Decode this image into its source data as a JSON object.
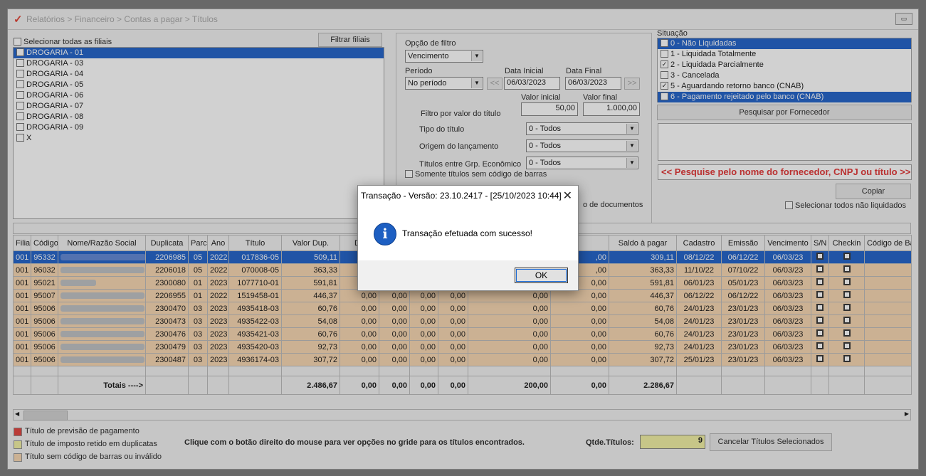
{
  "window": {
    "title": "Relatórios > Financeiro > Contas a pagar > Títulos",
    "restore_label": "▭"
  },
  "filiais": {
    "select_all_label": "Selecionar todas as filiais",
    "filter_button": "Filtrar filiais",
    "items": [
      {
        "label": "DROGARIA - 01",
        "checked": true
      },
      {
        "label": "DROGARIA - 03",
        "checked": false
      },
      {
        "label": "DROGARIA - 04",
        "checked": false
      },
      {
        "label": "DROGARIA - 05",
        "checked": false
      },
      {
        "label": "DROGARIA - 06",
        "checked": false
      },
      {
        "label": "DROGARIA - 07",
        "checked": false
      },
      {
        "label": "DROGARIA - 08",
        "checked": false
      },
      {
        "label": "DROGARIA - 09",
        "checked": false
      },
      {
        "label": "X",
        "checked": false
      }
    ]
  },
  "filter": {
    "option_label": "Opção de filtro",
    "option_value": "Vencimento",
    "period_label": "Período",
    "period_value": "No período",
    "prev_btn": "<<",
    "next_btn": ">>",
    "start_label": "Data Inicial",
    "start_value": "06/03/2023",
    "end_label": "Data Final",
    "end_value": "06/03/2023",
    "min_label": "Valor inicial",
    "max_label": "Valor final",
    "min_value": "50,00",
    "max_value": "1.000,00",
    "by_value_label": "Filtro por valor do título",
    "type_label": "Tipo do título",
    "type_value": "0 - Todos",
    "origin_label": "Origem do lançamento",
    "origin_value": "0 - Todos",
    "group_label": "Títulos entre Grp. Econômico",
    "group_value": "0 - Todos",
    "no_barcode_label": "Somente títulos sem código de barras",
    "docs_label": "o de documentos"
  },
  "situacao": {
    "label": "Situação",
    "items": [
      {
        "label": "0 - Não Liquidadas",
        "checked": true,
        "selected": true
      },
      {
        "label": "1 - Liquidada Totalmente",
        "checked": false,
        "selected": false
      },
      {
        "label": "2 - Liquidada Parcialmente",
        "checked": true,
        "selected": false
      },
      {
        "label": "3 - Cancelada",
        "checked": false,
        "selected": false
      },
      {
        "label": "5 - Aguardando retorno banco (CNAB)",
        "checked": true,
        "selected": false
      },
      {
        "label": "6 - Pagamento rejeitado pelo banco (CNAB)",
        "checked": true,
        "selected": true
      }
    ],
    "search_button": "Pesquisar por Fornecedor",
    "hint": "<< Pesquise pelo nome do fornecedor, CNPJ ou título >>",
    "copy_button": "Copiar",
    "select_unpaid_label": "Selecionar todos não liquidados"
  },
  "grid": {
    "columns": [
      "Filial",
      "Código",
      "Nome/Razão Social",
      "Duplicata",
      "Parc",
      "Ano",
      "Título",
      "Valor Dup.",
      "De",
      "",
      "",
      "",
      "",
      "",
      "Saldo à pagar",
      "Cadastro",
      "Emissão",
      "Vencimento",
      "S/N",
      "Checkin",
      "Código de Barras"
    ],
    "rows": [
      {
        "filial": "001",
        "codigo": "95332",
        "dup": "2206985",
        "parc": "05",
        "ano": "2022",
        "titulo": "017836-05",
        "valor": "509,11",
        "c1": "",
        "c2": "",
        "c3": "",
        "c4": "",
        "c5": "",
        "c6": ",00",
        "saldo": "309,11",
        "cadastro": "08/12/22",
        "emissao": "06/12/22",
        "venc": "06/03/23",
        "selected": true,
        "name_w": 120
      },
      {
        "filial": "001",
        "codigo": "96032",
        "dup": "2206018",
        "parc": "05",
        "ano": "2022",
        "titulo": "070008-05",
        "valor": "363,33",
        "c1": "",
        "c2": "",
        "c3": "",
        "c4": "",
        "c5": "",
        "c6": ",00",
        "saldo": "363,33",
        "cadastro": "11/10/22",
        "emissao": "07/10/22",
        "venc": "06/03/23",
        "selected": false,
        "name_w": 118
      },
      {
        "filial": "001",
        "codigo": "95021",
        "dup": "2300080",
        "parc": "01",
        "ano": "2023",
        "titulo": "1077710-01",
        "valor": "591,81",
        "c1": "0,00",
        "c2": "0,00",
        "c3": "0,00",
        "c4": "0,00",
        "c5": "0,00",
        "c6": "0,00",
        "saldo": "591,81",
        "cadastro": "06/01/23",
        "emissao": "05/01/23",
        "venc": "06/03/23",
        "selected": false,
        "name_w": 50
      },
      {
        "filial": "001",
        "codigo": "95007",
        "dup": "2206955",
        "parc": "01",
        "ano": "2022",
        "titulo": "1519458-01",
        "valor": "446,37",
        "c1": "0,00",
        "c2": "0,00",
        "c3": "0,00",
        "c4": "0,00",
        "c5": "0,00",
        "c6": "0,00",
        "saldo": "446,37",
        "cadastro": "06/12/22",
        "emissao": "06/12/22",
        "venc": "06/03/23",
        "selected": false,
        "name_w": 118
      },
      {
        "filial": "001",
        "codigo": "95006",
        "dup": "2300470",
        "parc": "03",
        "ano": "2023",
        "titulo": "4935418-03",
        "valor": "60,76",
        "c1": "0,00",
        "c2": "0,00",
        "c3": "0,00",
        "c4": "0,00",
        "c5": "0,00",
        "c6": "0,00",
        "saldo": "60,76",
        "cadastro": "24/01/23",
        "emissao": "23/01/23",
        "venc": "06/03/23",
        "selected": false,
        "name_w": 118
      },
      {
        "filial": "001",
        "codigo": "95006",
        "dup": "2300473",
        "parc": "03",
        "ano": "2023",
        "titulo": "4935422-03",
        "valor": "54,08",
        "c1": "0,00",
        "c2": "0,00",
        "c3": "0,00",
        "c4": "0,00",
        "c5": "0,00",
        "c6": "0,00",
        "saldo": "54,08",
        "cadastro": "24/01/23",
        "emissao": "23/01/23",
        "venc": "06/03/23",
        "selected": false,
        "name_w": 118
      },
      {
        "filial": "001",
        "codigo": "95006",
        "dup": "2300476",
        "parc": "03",
        "ano": "2023",
        "titulo": "4935421-03",
        "valor": "60,76",
        "c1": "0,00",
        "c2": "0,00",
        "c3": "0,00",
        "c4": "0,00",
        "c5": "0,00",
        "c6": "0,00",
        "saldo": "60,76",
        "cadastro": "24/01/23",
        "emissao": "23/01/23",
        "venc": "06/03/23",
        "selected": false,
        "name_w": 118
      },
      {
        "filial": "001",
        "codigo": "95006",
        "dup": "2300479",
        "parc": "03",
        "ano": "2023",
        "titulo": "4935420-03",
        "valor": "92,73",
        "c1": "0,00",
        "c2": "0,00",
        "c3": "0,00",
        "c4": "0,00",
        "c5": "0,00",
        "c6": "0,00",
        "saldo": "92,73",
        "cadastro": "24/01/23",
        "emissao": "23/01/23",
        "venc": "06/03/23",
        "selected": false,
        "name_w": 118
      },
      {
        "filial": "001",
        "codigo": "95006",
        "dup": "2300487",
        "parc": "03",
        "ano": "2023",
        "titulo": "4936174-03",
        "valor": "307,72",
        "c1": "0,00",
        "c2": "0,00",
        "c3": "0,00",
        "c4": "0,00",
        "c5": "0,00",
        "c6": "0,00",
        "saldo": "307,72",
        "cadastro": "25/01/23",
        "emissao": "23/01/23",
        "venc": "06/03/23",
        "selected": false,
        "name_w": 118
      }
    ],
    "totals": {
      "label": "Totais ---->",
      "valor": "2.486,67",
      "c1": "0,00",
      "c2": "0,00",
      "c3": "0,00",
      "c4": "0,00",
      "c5": "200,00",
      "c6": "0,00",
      "saldo": "2.286,67"
    }
  },
  "legend": [
    {
      "label": "Título de previsão de pagamento",
      "color": "#e0302a"
    },
    {
      "label": "Título de imposto retido em duplicatas",
      "color": "#f2f09a"
    },
    {
      "label": "Título sem código de barras ou inválido",
      "color": "#f7d3a9"
    }
  ],
  "footer": {
    "hint": "Clique com o botão direito do mouse para ver opções no gride para os títulos encontrados.",
    "qty_label": "Qtde.Títulos:",
    "qty_value": "9",
    "cancel_button": "Cancelar Títulos Selecionados"
  },
  "dialog": {
    "title": "Transação - Versão: 23.10.2417 - [25/10/2023 10:44]",
    "close": "✕",
    "icon": "i",
    "message": "Transação efetuada com sucesso!",
    "ok": "OK"
  },
  "colors": {
    "selection": "#0b52c4",
    "row_bg": "#f7d3a9",
    "hint_red": "#e02020"
  }
}
